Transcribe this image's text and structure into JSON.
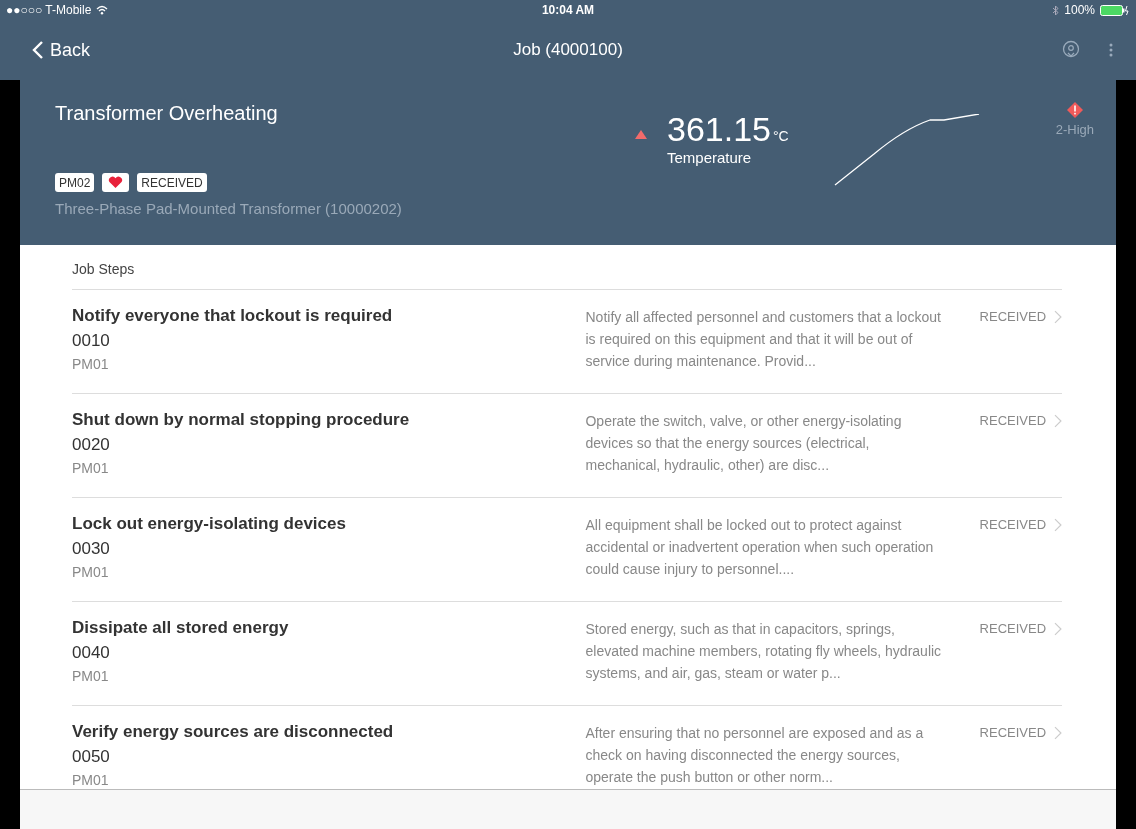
{
  "status_bar": {
    "carrier": "●●○○○ T-Mobile",
    "time": "10:04 AM",
    "battery": "100%"
  },
  "nav": {
    "back": "Back",
    "title": "Job (4000100)"
  },
  "header": {
    "title": "Transformer Overheating",
    "tags": [
      {
        "kind": "text",
        "label": "PM02"
      },
      {
        "kind": "heart"
      },
      {
        "kind": "text",
        "label": "RECEIVED"
      }
    ],
    "equipment": "Three-Phase Pad-Mounted Transformer (10000202)",
    "reading": {
      "value": "361.15",
      "unit": "°C",
      "label": "Temperature"
    },
    "priority": "2-High"
  },
  "section_title": "Job Steps",
  "steps": [
    {
      "title": "Notify everyone that lockout is required",
      "number": "0010",
      "code": "PM01",
      "description": "Notify all affected personnel and customers that a lockout is required on this equipment and that it will be out of service during maintenance. Provid...",
      "status": "RECEIVED"
    },
    {
      "title": "Shut down by normal stopping procedure",
      "number": "0020",
      "code": "PM01",
      "description": "Operate the switch, valve, or other energy-isolating devices so that the energy sources (electrical, mechanical, hydraulic, other) are disc...",
      "status": "RECEIVED"
    },
    {
      "title": "Lock out energy-isolating devices",
      "number": "0030",
      "code": "PM01",
      "description": "All equipment shall be locked out to protect against accidental or inadvertent operation when such operation could cause injury to personnel....",
      "status": "RECEIVED"
    },
    {
      "title": "Dissipate all stored energy",
      "number": "0040",
      "code": "PM01",
      "description": "Stored energy, such as that in capacitors, springs, elevated machine members, rotating fly wheels, hydraulic systems, and air, gas, steam or water p...",
      "status": "RECEIVED"
    },
    {
      "title": "Verify energy sources are disconnected",
      "number": "0050",
      "code": "PM01",
      "description": "After ensuring that no personnel are exposed and as a check on having disconnected the energy sources, operate the push button or other norm...",
      "status": "RECEIVED"
    }
  ]
}
